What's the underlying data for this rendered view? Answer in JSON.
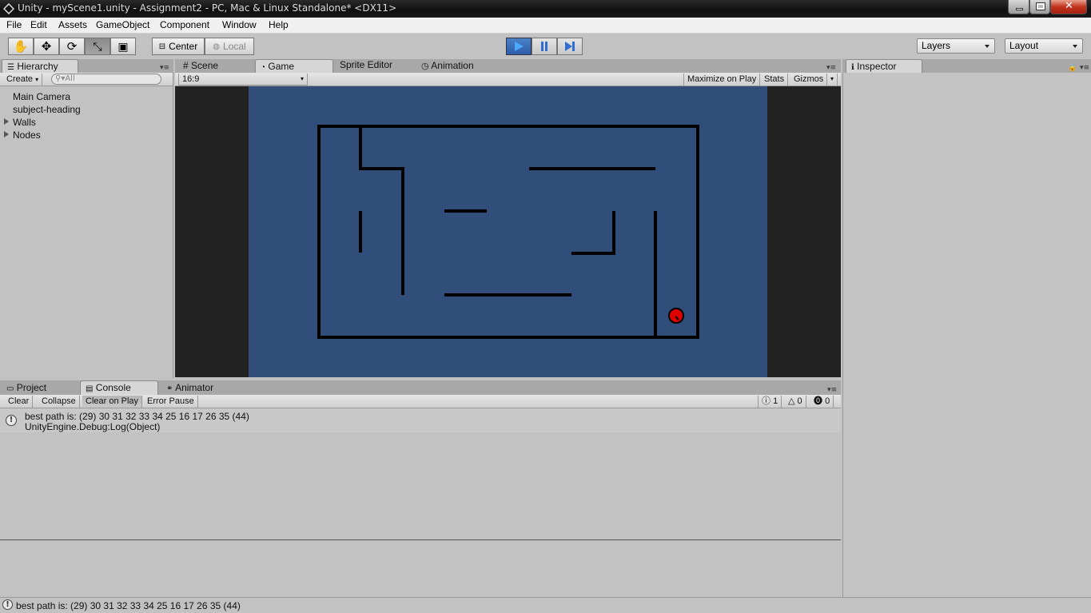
{
  "window": {
    "title": "Unity - myScene1.unity - Assignment2 - PC, Mac & Linux Standalone* <DX11>"
  },
  "menu": [
    "File",
    "Edit",
    "Assets",
    "GameObject",
    "Component",
    "Window",
    "Help"
  ],
  "toolbar": {
    "pivot_label": "Center",
    "space_label": "Local",
    "layers_label": "Layers",
    "layout_label": "Layout"
  },
  "hierarchy": {
    "tab_label": "Hierarchy",
    "create_label": "Create",
    "search_placeholder": "All",
    "items": [
      {
        "label": "Main Camera",
        "expandable": false
      },
      {
        "label": "subject-heading",
        "expandable": false
      },
      {
        "label": "Walls",
        "expandable": true
      },
      {
        "label": "Nodes",
        "expandable": true
      }
    ]
  },
  "center_tabs": [
    "Scene",
    "Game",
    "Sprite Editor",
    "Animation"
  ],
  "game": {
    "aspect": "16:9",
    "maximize_label": "Maximize on Play",
    "stats_label": "Stats",
    "gizmos_label": "Gizmos",
    "background_color": "#314d79",
    "player_color": "#e00000"
  },
  "inspector": {
    "tab_label": "Inspector"
  },
  "bottom_tabs": [
    "Project",
    "Console",
    "Animator"
  ],
  "console": {
    "buttons": [
      "Clear",
      "Collapse",
      "Clear on Play",
      "Error Pause"
    ],
    "counts": {
      "info": "1",
      "warnings": "0",
      "errors": "0"
    },
    "messages": [
      {
        "line1": "best path is: (29) 30 31 32 33 34 25 16 17 26 35 (44)",
        "line2": "UnityEngine.Debug:Log(Object)"
      }
    ]
  },
  "status": {
    "text": "best path is: (29) 30 31 32 33 34 25 16 17 26 35 (44)"
  }
}
